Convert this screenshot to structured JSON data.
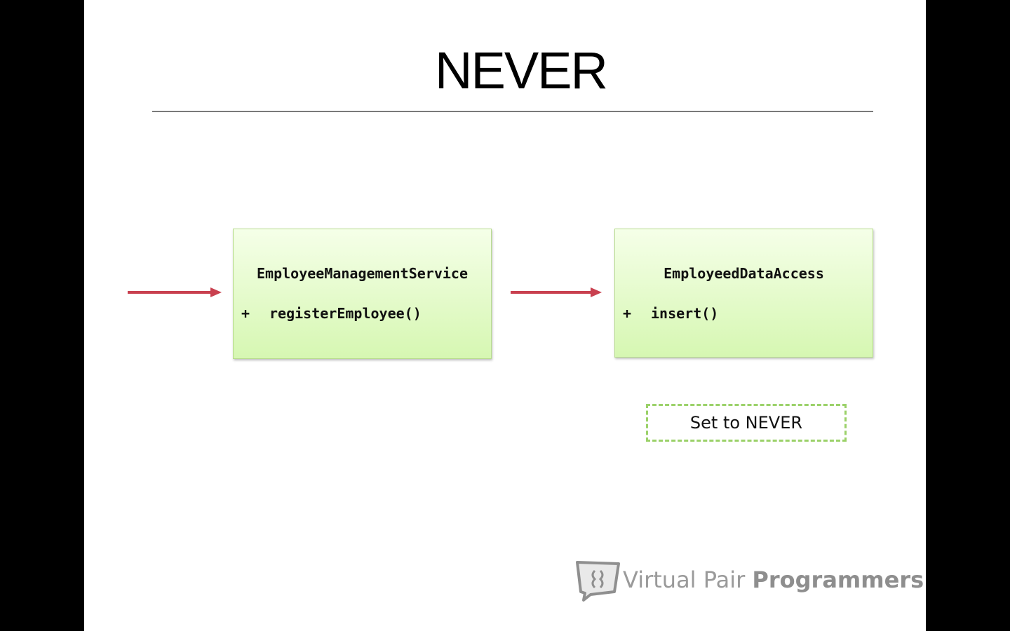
{
  "slide": {
    "title": "NEVER"
  },
  "diagram": {
    "boxes": [
      {
        "name": "EmployeeManagementService",
        "method_marker": "+",
        "method": "registerEmployee()"
      },
      {
        "name": "EmployeedDataAccess",
        "method_marker": "+",
        "method": "insert()"
      }
    ],
    "note": "Set to NEVER",
    "arrow_color": "#c9404f",
    "box_fill": "#d6f7b2",
    "note_border_color": "#9bd169"
  },
  "branding": {
    "light_text": "Virtual Pair ",
    "bold_text": "Programmers",
    "icon": "speech-bubble-logo-icon"
  }
}
